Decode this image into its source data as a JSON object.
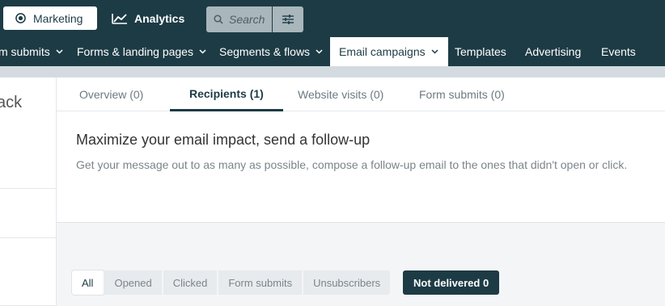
{
  "topbar": {
    "marketing_label": "Marketing",
    "analytics_label": "Analytics",
    "search_placeholder": "Search",
    "icons": {
      "marketing": "target-icon",
      "analytics": "trend-chart-icon",
      "search": "search-icon",
      "filter": "sliders-icon"
    }
  },
  "navbar": {
    "items": [
      {
        "label": "m submits",
        "has_dropdown": true
      },
      {
        "label": "Forms & landing pages",
        "has_dropdown": true
      },
      {
        "label": "Segments & flows",
        "has_dropdown": true
      },
      {
        "label": "Email campaigns",
        "has_dropdown": true,
        "active": true
      },
      {
        "label": "Templates",
        "has_dropdown": false
      },
      {
        "label": "Advertising",
        "has_dropdown": false
      },
      {
        "label": "Events",
        "has_dropdown": false
      }
    ]
  },
  "left": {
    "title": "ack"
  },
  "tabs": [
    {
      "label": "Overview (0)"
    },
    {
      "label": "Recipients (1)",
      "active": true
    },
    {
      "label": "Website visits (0)"
    },
    {
      "label": "Form submits (0)"
    }
  ],
  "followup": {
    "heading": "Maximize your email impact, send a follow-up",
    "description": "Get your message out to as many as possible, compose a follow-up email to the ones that didn't open or click."
  },
  "filters": {
    "buttons": [
      {
        "label": "All",
        "active": true
      },
      {
        "label": "Opened"
      },
      {
        "label": "Clicked"
      },
      {
        "label": "Form submits"
      },
      {
        "label": "Unsubscribers"
      }
    ],
    "not_delivered_label": "Not delivered 0"
  },
  "colors": {
    "brand_dark": "#1d3b45",
    "search_bg": "#a9b6bb",
    "subbar": "#d3dbe0"
  }
}
